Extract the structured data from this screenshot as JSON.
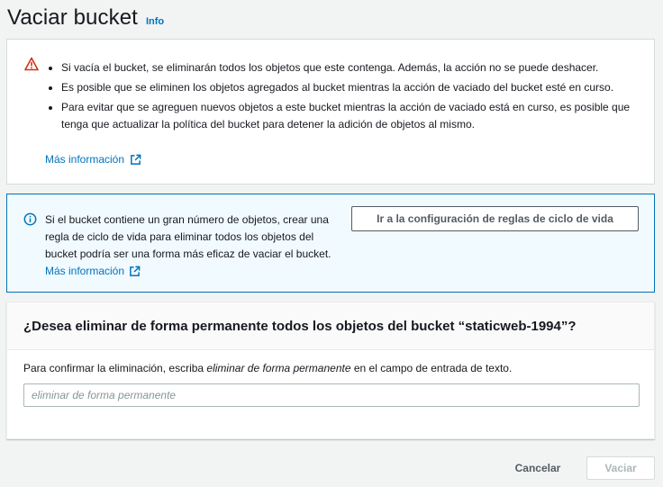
{
  "header": {
    "title": "Vaciar bucket",
    "info_label": "Info"
  },
  "warning": {
    "items": [
      "Si vacía el bucket, se eliminarán todos los objetos que este contenga. Además, la acción no se puede deshacer.",
      "Es posible que se eliminen los objetos agregados al bucket mientras la acción de vaciado del bucket esté en curso.",
      "Para evitar que se agreguen nuevos objetos a este bucket mientras la acción de vaciado está en curso, es posible que tenga que actualizar la política del bucket para detener la adición de objetos al mismo."
    ],
    "more_info": "Más información",
    "icon": "warning-triangle-icon",
    "icon_color": "#d13212"
  },
  "info_alert": {
    "text": "Si el bucket contiene un gran número de objetos, crear una regla de ciclo de vida para eliminar todos los objetos del bucket podría ser una forma más eficaz de vaciar el bucket.",
    "more_info": "Más información",
    "button_label": "Ir a la configuración de reglas de ciclo de vida",
    "icon": "info-circle-icon",
    "accent_color": "#0073bb"
  },
  "confirm": {
    "title": "¿Desea eliminar de forma permanente todos los objetos del bucket “staticweb-1994”?",
    "instruction_prefix": "Para confirmar la eliminación, escriba ",
    "instruction_emphasis": "eliminar de forma permanente",
    "instruction_suffix": " en el campo de entrada de texto.",
    "input_value": "",
    "input_placeholder": "eliminar de forma permanente"
  },
  "footer": {
    "cancel_label": "Cancelar",
    "submit_label": "Vaciar"
  }
}
